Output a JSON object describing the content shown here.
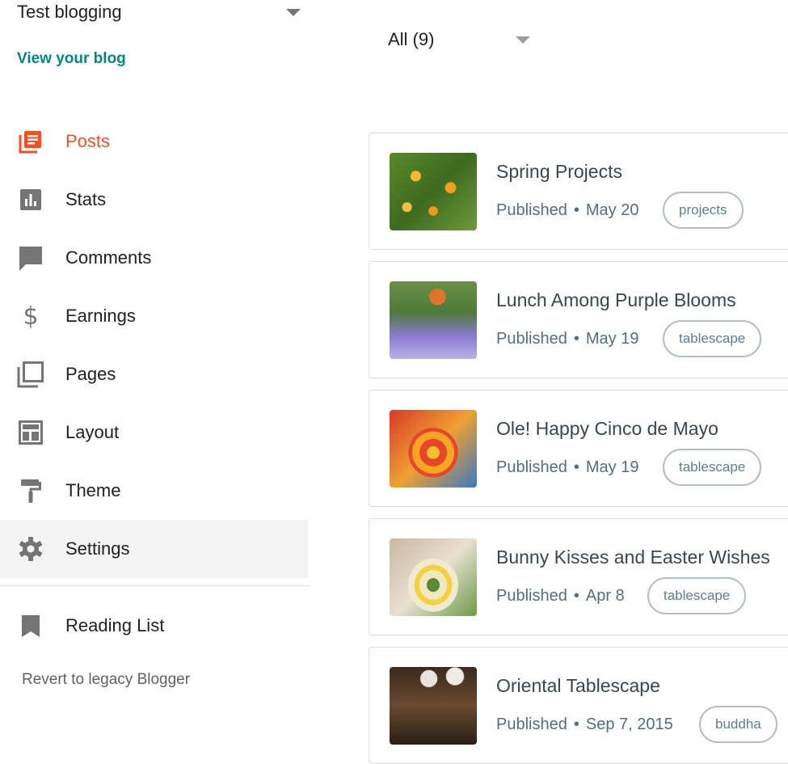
{
  "sidebar": {
    "blog_name": "Test blogging",
    "view_blog": "View your blog",
    "nav": [
      {
        "label": "Posts",
        "icon": "posts-icon"
      },
      {
        "label": "Stats",
        "icon": "stats-icon"
      },
      {
        "label": "Comments",
        "icon": "comments-icon"
      },
      {
        "label": "Earnings",
        "icon": "dollar-icon"
      },
      {
        "label": "Pages",
        "icon": "pages-icon"
      },
      {
        "label": "Layout",
        "icon": "layout-icon"
      },
      {
        "label": "Theme",
        "icon": "paint-roller-icon"
      },
      {
        "label": "Settings",
        "icon": "gear-icon"
      }
    ],
    "reading_list": "Reading List",
    "revert": "Revert to legacy Blogger"
  },
  "filter": {
    "label": "All (9)"
  },
  "posts": [
    {
      "title": "Spring Projects",
      "status": "Published",
      "date": "May 20",
      "tag": "projects"
    },
    {
      "title": "Lunch Among Purple Blooms",
      "status": "Published",
      "date": "May 19",
      "tag": "tablescape"
    },
    {
      "title": "Ole! Happy Cinco de Mayo",
      "status": "Published",
      "date": "May 19",
      "tag": "tablescape"
    },
    {
      "title": "Bunny Kisses and Easter Wishes",
      "status": "Published",
      "date": "Apr 8",
      "tag": "tablescape"
    },
    {
      "title": "Oriental Tablescape",
      "status": "Published",
      "date": "Sep 7, 2015",
      "tag": "buddha"
    }
  ],
  "colors": {
    "accent": "#f4511e",
    "link": "#00897b",
    "icon": "#757575"
  }
}
